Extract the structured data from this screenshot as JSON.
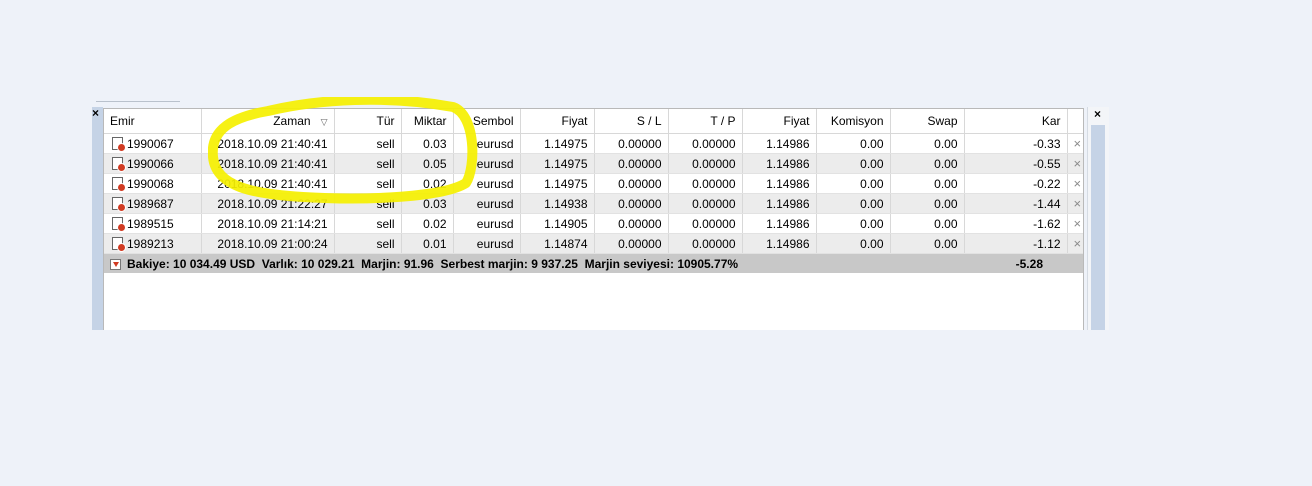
{
  "columns": [
    "Emir",
    "Zaman",
    "Tür",
    "Miktar",
    "Sembol",
    "Fiyat",
    "S / L",
    "T / P",
    "Fiyat",
    "Komisyon",
    "Swap",
    "Kar"
  ],
  "rows": [
    {
      "emir": "1990067",
      "zaman": "2018.10.09 21:40:41",
      "tur": "sell",
      "miktar": "0.03",
      "sembol": "eurusd",
      "fiyat": "1.14975",
      "sl": "0.00000",
      "tp": "0.00000",
      "fiyat2": "1.14986",
      "komisyon": "0.00",
      "swap": "0.00",
      "kar": "-0.33"
    },
    {
      "emir": "1990066",
      "zaman": "2018.10.09 21:40:41",
      "tur": "sell",
      "miktar": "0.05",
      "sembol": "eurusd",
      "fiyat": "1.14975",
      "sl": "0.00000",
      "tp": "0.00000",
      "fiyat2": "1.14986",
      "komisyon": "0.00",
      "swap": "0.00",
      "kar": "-0.55"
    },
    {
      "emir": "1990068",
      "zaman": "2018.10.09 21:40:41",
      "tur": "sell",
      "miktar": "0.02",
      "sembol": "eurusd",
      "fiyat": "1.14975",
      "sl": "0.00000",
      "tp": "0.00000",
      "fiyat2": "1.14986",
      "komisyon": "0.00",
      "swap": "0.00",
      "kar": "-0.22"
    },
    {
      "emir": "1989687",
      "zaman": "2018.10.09 21:22:27",
      "tur": "sell",
      "miktar": "0.03",
      "sembol": "eurusd",
      "fiyat": "1.14938",
      "sl": "0.00000",
      "tp": "0.00000",
      "fiyat2": "1.14986",
      "komisyon": "0.00",
      "swap": "0.00",
      "kar": "-1.44"
    },
    {
      "emir": "1989515",
      "zaman": "2018.10.09 21:14:21",
      "tur": "sell",
      "miktar": "0.02",
      "sembol": "eurusd",
      "fiyat": "1.14905",
      "sl": "0.00000",
      "tp": "0.00000",
      "fiyat2": "1.14986",
      "komisyon": "0.00",
      "swap": "0.00",
      "kar": "-1.62"
    },
    {
      "emir": "1989213",
      "zaman": "2018.10.09 21:00:24",
      "tur": "sell",
      "miktar": "0.01",
      "sembol": "eurusd",
      "fiyat": "1.14874",
      "sl": "0.00000",
      "tp": "0.00000",
      "fiyat2": "1.14986",
      "komisyon": "0.00",
      "swap": "0.00",
      "kar": "-1.12"
    }
  ],
  "summary": {
    "text": "Bakiye: 10 034.49 USD  Varlık: 10 029.21  Marjin: 91.96  Serbest marjin: 9 937.25  Marjin seviyesi: 10905.77%",
    "total": "-5.28"
  },
  "close_glyph": "×",
  "window_close_glyph": "×",
  "sort_glyph": "▽",
  "colors": {
    "highlight": "#f5f000",
    "row_alt": "#ececec",
    "summary_bg": "#c8c8c8",
    "icon_red": "#d13b22"
  },
  "icons": {
    "row": "sell-order-document-icon",
    "summary": "account-summary-icon",
    "close_row": "close-position-icon",
    "close_window": "close-window-icon"
  }
}
